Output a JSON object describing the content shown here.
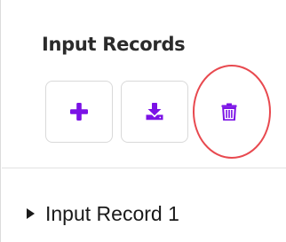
{
  "panel": {
    "title": "Input Records"
  },
  "toolbar": {
    "buttons": [
      {
        "icon": "plus-icon"
      },
      {
        "icon": "download-icon"
      },
      {
        "icon": "trash-icon"
      }
    ],
    "accent_color": "#7b12e6"
  },
  "annotation": {
    "ring_color": "#e8494f"
  },
  "records": {
    "items": [
      {
        "label": "Input Record 1",
        "expanded": false
      }
    ]
  }
}
